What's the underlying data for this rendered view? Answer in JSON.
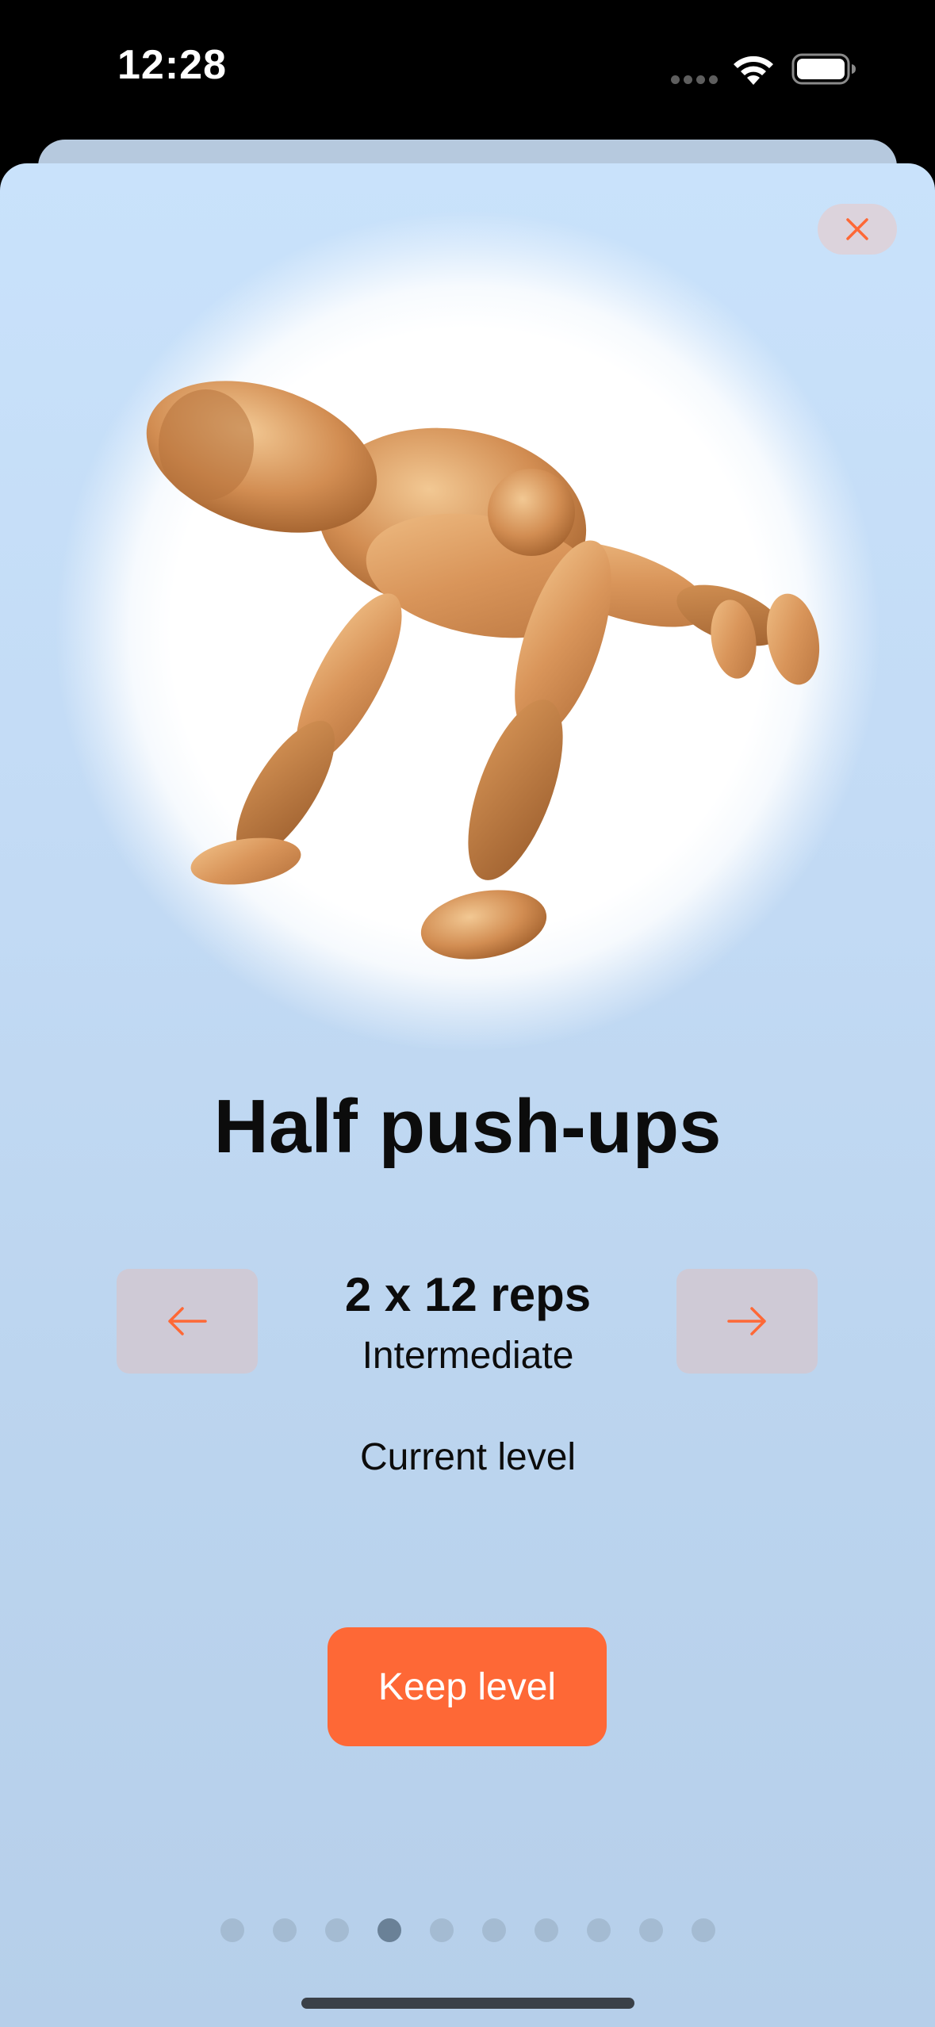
{
  "status_bar": {
    "time": "12:28",
    "icons": [
      "cellular-dots-icon",
      "wifi-icon",
      "battery-icon"
    ]
  },
  "close_icon": "close-icon",
  "figure_icon": "wooden-mannequin-half-pushup-figure",
  "exercise": {
    "title": "Half push-ups",
    "reps": "2 x 12 reps",
    "level": "Intermediate",
    "status": "Current level"
  },
  "navigation": {
    "prev_icon": "arrow-left-icon",
    "next_icon": "arrow-right-icon"
  },
  "action": {
    "keep_label": "Keep level"
  },
  "pagination": {
    "total": 10,
    "current": 4
  },
  "colors": {
    "accent": "#FE6836",
    "sheet_top": "#C9E2FB",
    "sheet_bottom": "#B6CFEA",
    "nav_button": "#CFCAD6",
    "dot": "#A4BBD2",
    "dot_active": "#6A8197"
  }
}
